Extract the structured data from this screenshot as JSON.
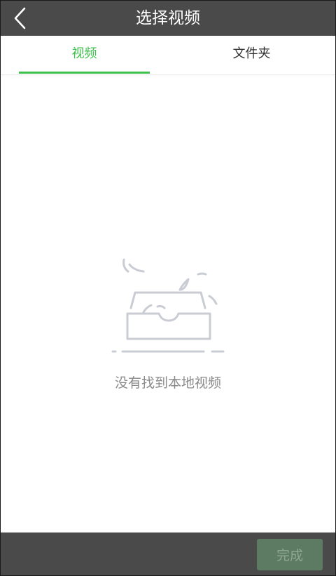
{
  "header": {
    "title": "选择视频",
    "back_icon": "chevron-left-icon"
  },
  "tabs": [
    {
      "label": "视频",
      "active": true
    },
    {
      "label": "文件夹",
      "active": false
    }
  ],
  "empty_state": {
    "icon": "empty-box-icon",
    "message": "没有找到本地视频"
  },
  "footer": {
    "done_label": "完成",
    "done_enabled": false
  },
  "colors": {
    "header_bg": "#4a4a4a",
    "accent_green": "#3ec04c",
    "tab_inactive_text": "#333333",
    "empty_text": "#8a8a8a",
    "done_button_bg_disabled": "#5d7a62",
    "done_button_text_disabled": "#8fa893"
  }
}
